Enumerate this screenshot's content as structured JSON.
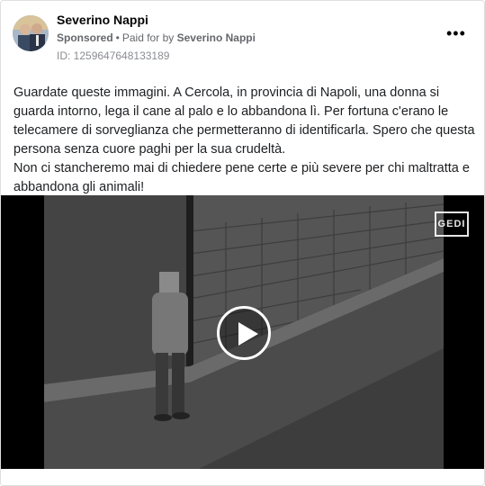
{
  "post": {
    "author": "Severino Nappi",
    "sponsored_label": "Sponsored",
    "separator": "•",
    "paid_for_label": "Paid for by",
    "paid_for_name": "Severino Nappi",
    "library_id": "ID: 1259647648133189",
    "more_options": "•••",
    "text_paragraph_1": "Guardate queste immagini. A Cercola, in provincia di Napoli, una donna si guarda intorno, lega il cane al palo e lo abbandona lì. Per fortuna c'erano le telecamere di sorveglianza che permetteranno di identificarla. Spero che questa persona senza cuore paghi per la sua crudeltà.",
    "text_paragraph_2": "Non ci stancheremo mai di chiedere pene certe e più severe per chi maltratta e abbandona gli animali!"
  },
  "video": {
    "watermark": "GEDI",
    "icons": [
      "play-icon"
    ]
  },
  "colors": {
    "text_primary": "#050505",
    "text_secondary": "#65676b",
    "border": "#dddfe2",
    "video_bg": "#000000"
  }
}
